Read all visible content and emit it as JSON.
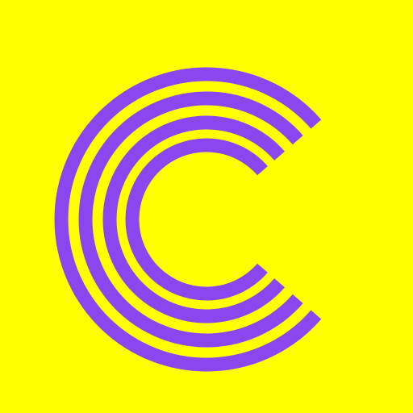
{
  "logo": {
    "background_color": "#FFFF00",
    "mark_color": "#8B46F0",
    "icon_name": "concentric-c-logo",
    "arc_count": 4
  }
}
